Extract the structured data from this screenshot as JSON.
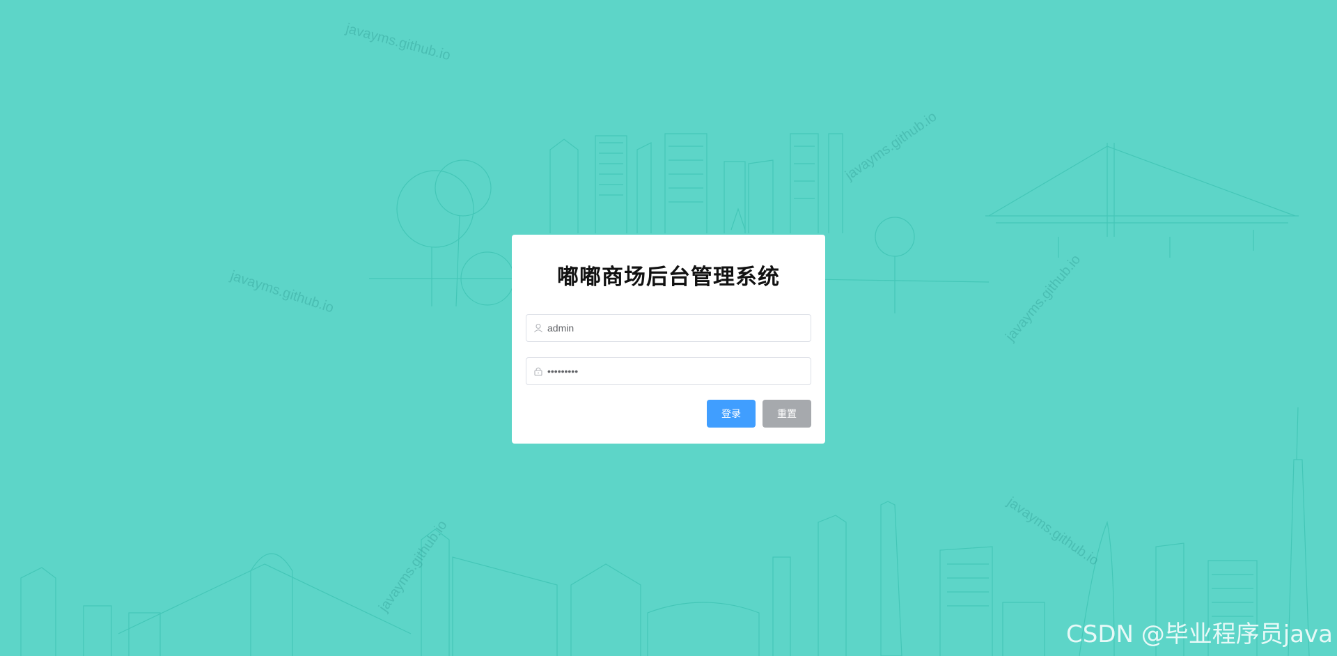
{
  "watermarks": {
    "site_text": "javayms.github.io",
    "corner_text": "CSDN @毕业程序员java"
  },
  "login": {
    "title": "嘟嘟商场后台管理系统",
    "username_value": "admin",
    "password_value": "•••••••••",
    "login_button": "登录",
    "reset_button": "重置"
  },
  "icons": {
    "username": "user-icon",
    "password": "lock-icon"
  },
  "colors": {
    "background": "#5dd5c8",
    "primary_button": "#409eff",
    "reset_button": "#a6a9ad"
  }
}
